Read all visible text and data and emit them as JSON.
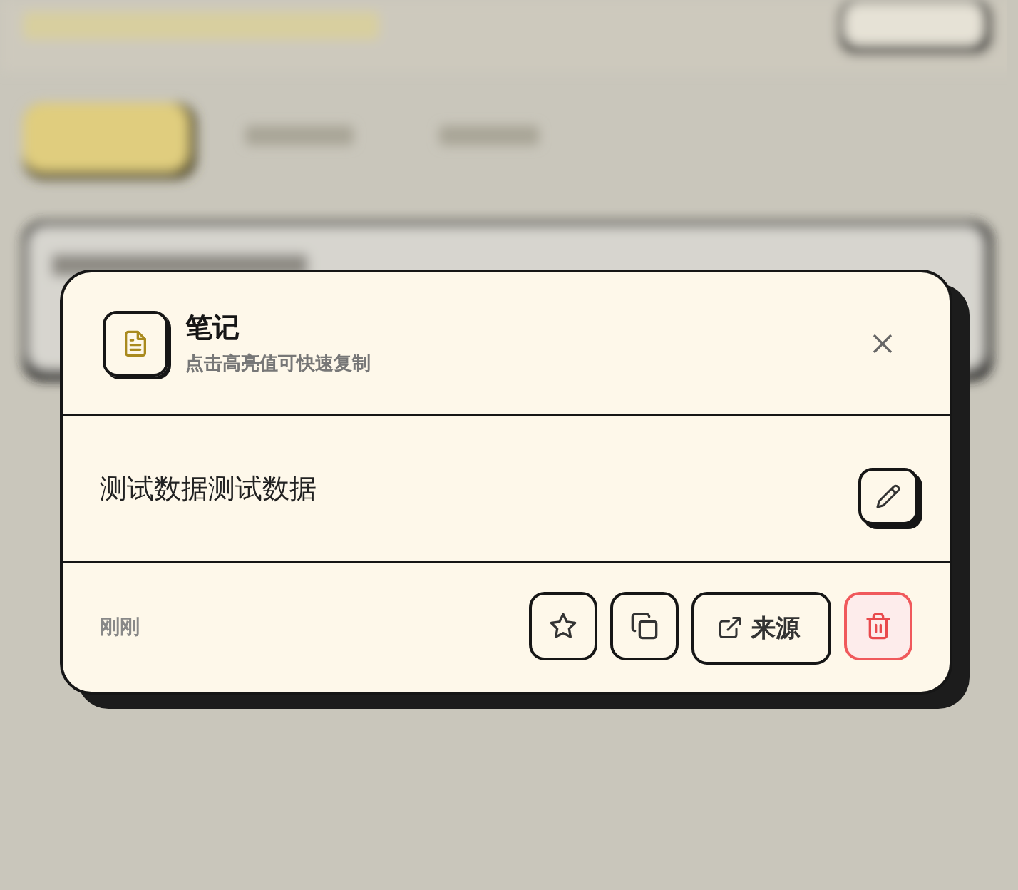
{
  "dialog": {
    "title": "笔记",
    "subtitle": "点击高亮值可快速复制",
    "content": "测试数据测试数据",
    "time": "刚刚",
    "actions": [
      {
        "kind": "star"
      },
      {
        "kind": "copy"
      },
      {
        "kind": "source",
        "label": "来源"
      },
      {
        "kind": "delete"
      }
    ]
  }
}
